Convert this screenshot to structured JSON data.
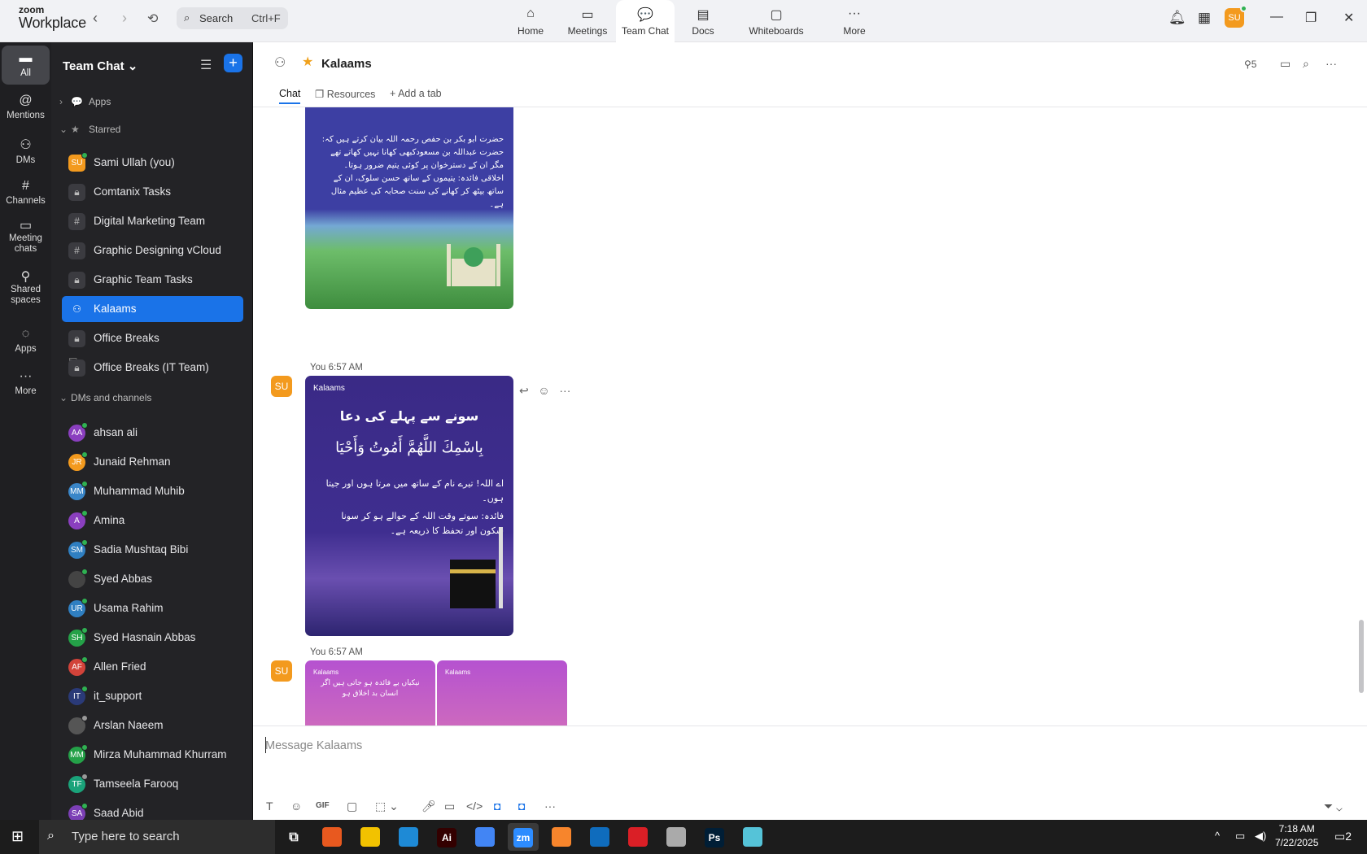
{
  "app": {
    "logo_top": "zoom",
    "logo_bottom": "Workplace"
  },
  "search": {
    "placeholder": "Search",
    "shortcut": "Ctrl+F"
  },
  "nav_tabs": [
    {
      "label": "Home",
      "icon": "home-icon"
    },
    {
      "label": "Meetings",
      "icon": "video-camera-icon"
    },
    {
      "label": "Team Chat",
      "icon": "chat-bubble-icon"
    },
    {
      "label": "Docs",
      "icon": "document-icon"
    },
    {
      "label": "Whiteboards",
      "icon": "whiteboard-icon"
    },
    {
      "label": "More",
      "icon": "more-dots-icon"
    }
  ],
  "active_tab": "Team Chat",
  "user_initials": "SU",
  "rail": [
    {
      "label": "All",
      "icon": "chat-icon"
    },
    {
      "label": "Mentions",
      "icon": "at-sign-icon"
    },
    {
      "label": "DMs",
      "icon": "people-icon"
    },
    {
      "label": "Channels",
      "icon": "hashtag-icon"
    },
    {
      "label_line1": "Meeting",
      "label_line2": "chats",
      "icon": "calendar-icon"
    },
    {
      "label_line1": "Shared",
      "label_line2": "spaces",
      "icon": "shared-spaces-icon"
    },
    {
      "label": "Apps",
      "icon": "apps-icon"
    },
    {
      "label": "More",
      "icon": "more-dots-icon"
    }
  ],
  "sidebar": {
    "title": "Team Chat",
    "sections": {
      "apps": "Apps",
      "starred": "Starred",
      "dms": "DMs and channels"
    },
    "starred": [
      {
        "label": "Sami Ullah (you)",
        "initials": "SU",
        "color": "#f39a1e",
        "status": "online"
      },
      {
        "label": "Comtanix Tasks",
        "type": "private"
      },
      {
        "label": "Digital Marketing Team",
        "type": "channel"
      },
      {
        "label": "Graphic Designing vCloud",
        "type": "channel"
      },
      {
        "label": "Graphic Team Tasks",
        "type": "private"
      },
      {
        "label": "Kalaams",
        "type": "group",
        "active": true
      },
      {
        "label": "Office Breaks",
        "type": "private"
      },
      {
        "label": "Office Breaks (IT Team)",
        "type": "private"
      }
    ],
    "dms": [
      {
        "label": "ahsan ali",
        "initials": "AA",
        "color": "#8a3fbf",
        "status": "online"
      },
      {
        "label": "Junaid Rehman",
        "initials": "JR",
        "color": "#f39a1e",
        "status": "online"
      },
      {
        "label": "Muhammad Muhib",
        "initials": "MM",
        "color": "#3a86c8",
        "status": "online"
      },
      {
        "label": "Amina",
        "initials": "A",
        "color": "#8a3fbf",
        "status": "online"
      },
      {
        "label": "Sadia Mushtaq Bibi",
        "initials": "SM",
        "color": "#2f7fc1",
        "status": "online"
      },
      {
        "label": "Syed Abbas",
        "initials": "",
        "color": "#444",
        "status": "online"
      },
      {
        "label": "Usama Rahim",
        "initials": "UR",
        "color": "#2f7fc1",
        "status": "online"
      },
      {
        "label": "Syed Hasnain Abbas",
        "initials": "SH",
        "color": "#24a148",
        "status": "online"
      },
      {
        "label": "Allen Fried",
        "initials": "AF",
        "color": "#d2433a",
        "status": "online"
      },
      {
        "label": "it_support",
        "initials": "IT",
        "color": "#2a3a78",
        "status": "online"
      },
      {
        "label": "Arslan Naeem",
        "initials": "",
        "color": "#555",
        "status": "away"
      },
      {
        "label": "Mirza Muhammad Khurram",
        "initials": "MM",
        "color": "#24a148",
        "status": "online"
      },
      {
        "label": "Tamseela Farooq",
        "initials": "TF",
        "color": "#1aa37a",
        "status": "away"
      },
      {
        "label": "Saad Abid",
        "initials": "SA",
        "color": "#7b3fb5",
        "status": "online"
      }
    ]
  },
  "channel": {
    "title": "Kalaams",
    "member_count": "5",
    "tabs": [
      "Chat",
      "Resources",
      "Add a tab"
    ]
  },
  "messages": [
    {
      "meta": "You 6:57 AM",
      "initials": "SU"
    },
    {
      "meta": "You 6:57 AM",
      "initials": "SU"
    }
  ],
  "cards": {
    "green_lines": [
      "حضرت ابو بکر بن حفص رحمہ اللہ بیان کرتے ہیں کہ:",
      "حضرت عبداللہ بن مسعودکبھی کھانا نہیں کھاتے تھے",
      "مگر ان کے دسترخوان پر کوئی یتیم ضرور ہوتا۔",
      "اخلاقی فائدہ: یتیموں کے ساتھ حسن سلوک، ان کے",
      "ساتھ بیٹھ کر کھانے کی سنت صحابہ کی عظیم مثال ہے۔"
    ],
    "purple_brand": "Kalaams",
    "purple_title": "سونے سے پہلے کی دعا",
    "purple_arabic": "بِاسْمِكَ اللَّهُمَّ أَمُوتُ وَأَحْيَا",
    "purple_lines": [
      "اے اللہ! تیرے نام کے ساتھ میں مرتا ہوں اور جیتا ہوں۔",
      "فائدہ: سوتے وقت اللہ کے حوالے ہو کر سونا سکون اور تحفظ کا ذریعہ ہے۔"
    ],
    "pink1_brand": "Kalaams",
    "pink1_title": "نیکیاں بے فائدہ ہو جاتی ہیں اگر انسان بد اخلاق ہو",
    "pink2_brand": "Kalaams"
  },
  "composer": {
    "placeholder": "Message Kalaams",
    "gif": "GIF"
  },
  "taskbar": {
    "search_placeholder": "Type here to search",
    "apps": [
      {
        "label": "",
        "icon": "task-view-icon"
      },
      {
        "label": "",
        "icon": "firefox-icon",
        "color": "#e8591f"
      },
      {
        "label": "",
        "icon": "file-explorer-icon",
        "color": "#f2c200"
      },
      {
        "label": "",
        "icon": "vscode-icon",
        "color": "#1e8ad6"
      },
      {
        "label": "Ai",
        "icon": "illustrator-icon",
        "color": "#330000"
      },
      {
        "label": "",
        "icon": "chrome-icon",
        "color": "#4285f4"
      },
      {
        "label": "zm",
        "icon": "zoom-icon",
        "color": "#2d8cff"
      },
      {
        "label": "",
        "icon": "xampp-icon",
        "color": "#f7852c"
      },
      {
        "label": "",
        "icon": "outlook-icon",
        "color": "#0f6cbd"
      },
      {
        "label": "",
        "icon": "creative-cloud-icon",
        "color": "#da1f26"
      },
      {
        "label": "",
        "icon": "pen-tool-icon",
        "color": "#aaa"
      },
      {
        "label": "Ps",
        "icon": "photoshop-icon",
        "color": "#001e36"
      },
      {
        "label": "",
        "icon": "app-icon",
        "color": "#55c3d8"
      }
    ],
    "time": "7:18 AM",
    "date": "7/22/2025",
    "notification_count": "2"
  }
}
